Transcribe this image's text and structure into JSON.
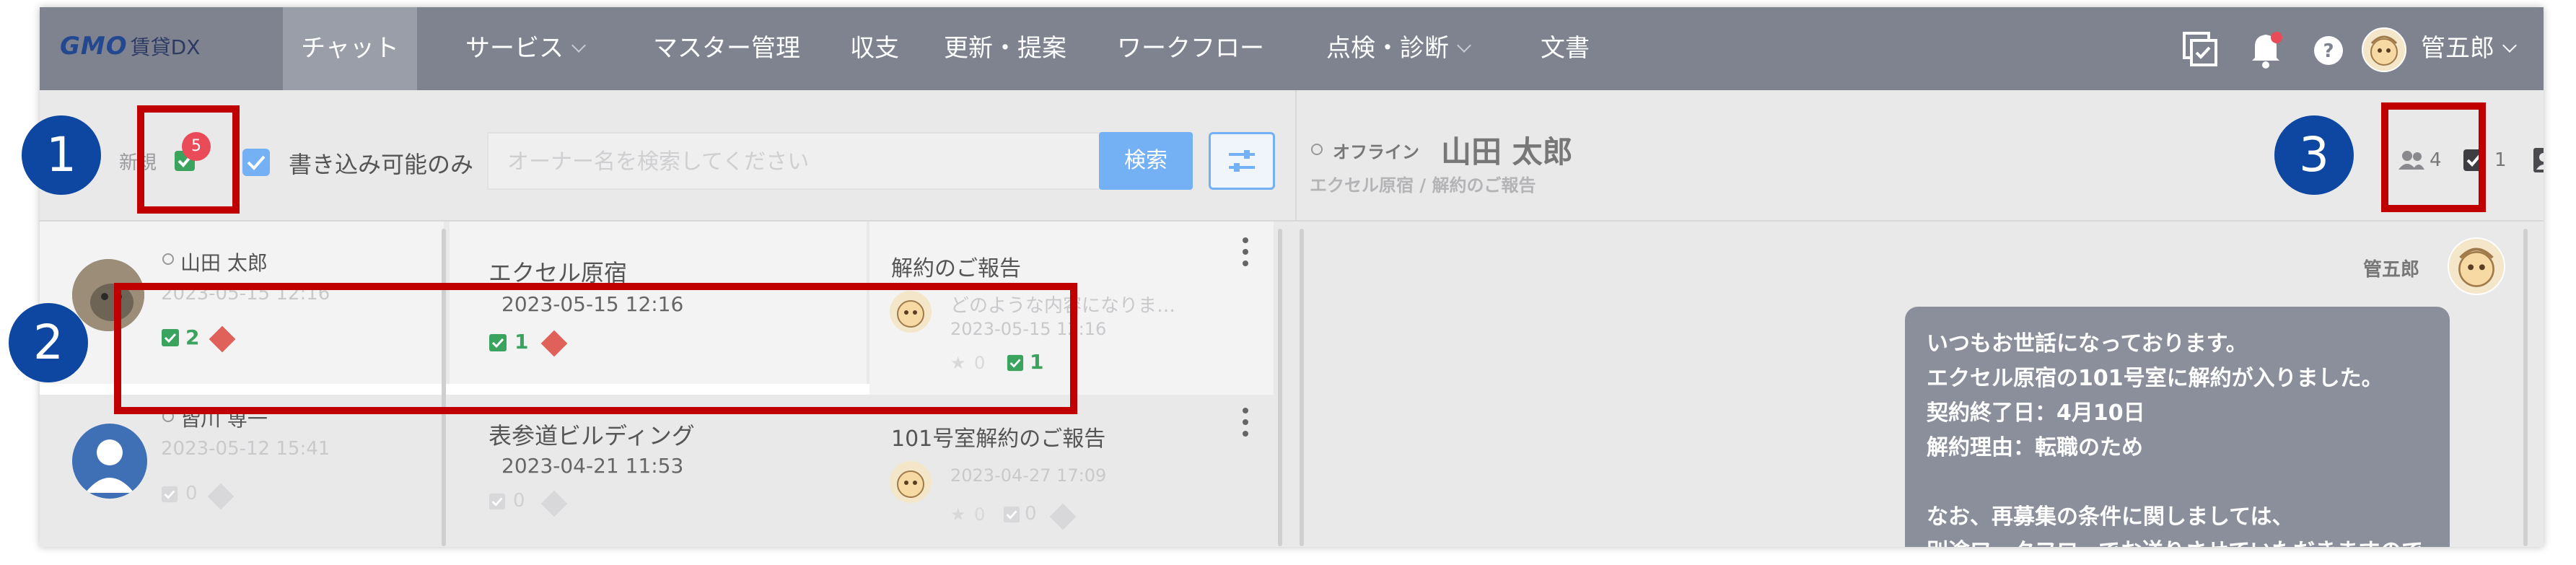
{
  "app": {
    "logo_brand": "GMO",
    "logo_product": "賃貸DX"
  },
  "nav": {
    "items": [
      {
        "label": "チャット",
        "active": true
      },
      {
        "label": "サービス",
        "dropdown": true
      },
      {
        "label": "マスター管理"
      },
      {
        "label": "収支"
      },
      {
        "label": "更新・提案"
      },
      {
        "label": "ワークフロー"
      },
      {
        "label": "点検・診断",
        "dropdown": true
      },
      {
        "label": "文書"
      }
    ],
    "user_name": "管五郎"
  },
  "toolbar": {
    "new_label": "新規",
    "new_badge": "5",
    "writable_only_label": "書き込み可能のみ",
    "search_placeholder": "オーナー名を検索してください",
    "search_button": "検索"
  },
  "conversation_header": {
    "status": "オフライン",
    "name": "山田 太郎",
    "breadcrumb": "エクセル原宿 / 解約のご報告",
    "members_count": "4",
    "task_count": "1"
  },
  "chat_list": [
    {
      "owner": "山田 太郎",
      "owner_time": "2023-05-15 12:16",
      "owner_task_count": "2",
      "property": "エクセル原宿",
      "property_time": "2023-05-15 12:16",
      "property_task_count": "1",
      "topic": "解約のご報告",
      "preview": "どのような内容になりま…",
      "topic_time": "2023-05-15 12:16",
      "star_count": "0",
      "topic_task_count": "1"
    },
    {
      "owner": "皆川 専一",
      "owner_time": "2023-05-12 15:41",
      "owner_task_count": "0",
      "property": "表参道ビルディング",
      "property_time": "2023-04-21 11:53",
      "property_task_count": "0",
      "topic": "101号室解約のご報告",
      "topic_time": "2023-04-27 17:09",
      "star_count": "0",
      "topic_task_count": "0"
    }
  ],
  "message": {
    "sender": "管五郎",
    "lines": [
      "いつもお世話になっております。",
      "エクセル原宿の101号室に解約が入りました。",
      "契約終了日：4月10日",
      "解約理由：転職のため",
      "",
      "なお、再募集の条件に関しましては、",
      "別途ワークフローでお送りさせていただきますので"
    ]
  },
  "callouts": [
    "1",
    "2",
    "3"
  ],
  "colors": {
    "nav_bg": "#7e838f",
    "accent_blue": "#74b0f4",
    "task_green": "#3aa35d",
    "badge_red": "#ea4b58",
    "annotation_red": "#c00000",
    "callout_blue": "#0d47a1"
  }
}
